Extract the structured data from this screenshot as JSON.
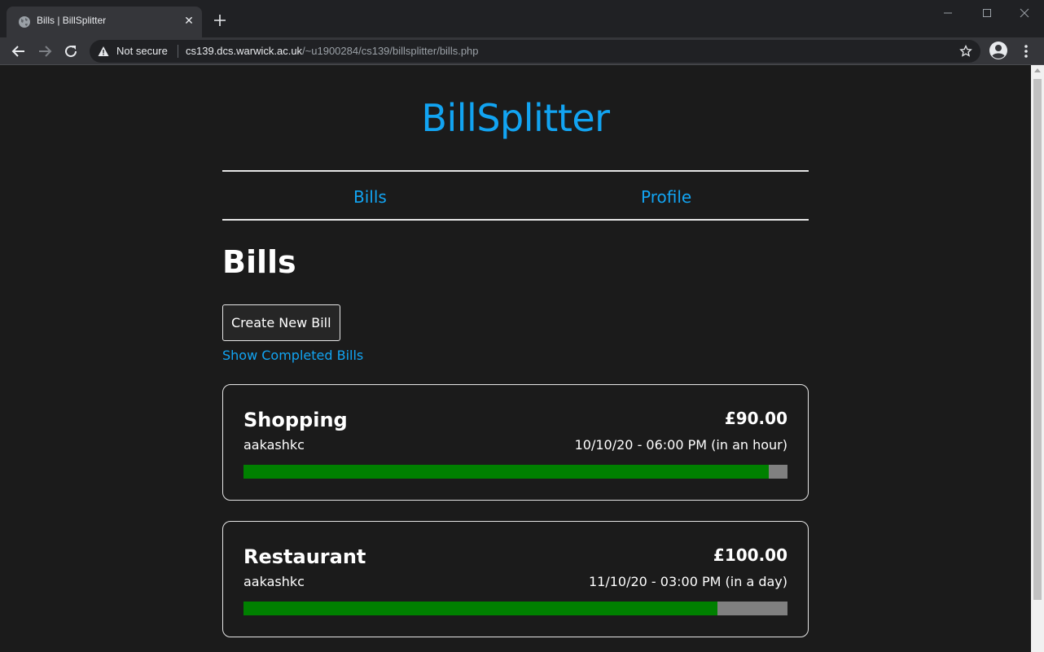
{
  "browser": {
    "tab_title": "Bills | BillSplitter",
    "security_label": "Not secure",
    "url_host": "cs139.dcs.warwick.ac.uk",
    "url_path": "/~u1900284/cs139/billsplitter/bills.php"
  },
  "site": {
    "title": "BillSplitter",
    "nav": [
      {
        "label": "Bills"
      },
      {
        "label": "Profile"
      }
    ]
  },
  "page": {
    "heading": "Bills",
    "create_button": "Create New Bill",
    "show_completed": "Show Completed Bills"
  },
  "bills": [
    {
      "name": "Shopping",
      "amount": "£90.00",
      "owner": "aakashkc",
      "date": "10/10/20 - 06:00 PM (in an hour)",
      "progress_fraction": 0.966
    },
    {
      "name": "Restaurant",
      "amount": "£100.00",
      "owner": "aakashkc",
      "date": "11/10/20 - 03:00 PM (in a day)",
      "progress_fraction": 0.871
    }
  ],
  "colors": {
    "accent": "#12a4f2",
    "background": "#1b1b1b",
    "progress_paid": "#008000",
    "progress_remaining": "#808080"
  }
}
